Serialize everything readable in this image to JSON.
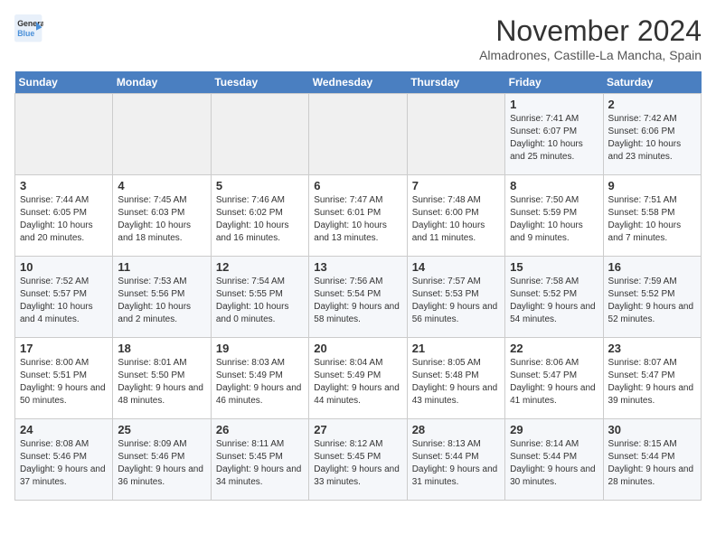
{
  "header": {
    "logo_line1": "General",
    "logo_line2": "Blue",
    "month": "November 2024",
    "location": "Almadrones, Castille-La Mancha, Spain"
  },
  "weekdays": [
    "Sunday",
    "Monday",
    "Tuesday",
    "Wednesday",
    "Thursday",
    "Friday",
    "Saturday"
  ],
  "weeks": [
    [
      {
        "day": "",
        "info": ""
      },
      {
        "day": "",
        "info": ""
      },
      {
        "day": "",
        "info": ""
      },
      {
        "day": "",
        "info": ""
      },
      {
        "day": "",
        "info": ""
      },
      {
        "day": "1",
        "info": "Sunrise: 7:41 AM\nSunset: 6:07 PM\nDaylight: 10 hours and 25 minutes."
      },
      {
        "day": "2",
        "info": "Sunrise: 7:42 AM\nSunset: 6:06 PM\nDaylight: 10 hours and 23 minutes."
      }
    ],
    [
      {
        "day": "3",
        "info": "Sunrise: 7:44 AM\nSunset: 6:05 PM\nDaylight: 10 hours and 20 minutes."
      },
      {
        "day": "4",
        "info": "Sunrise: 7:45 AM\nSunset: 6:03 PM\nDaylight: 10 hours and 18 minutes."
      },
      {
        "day": "5",
        "info": "Sunrise: 7:46 AM\nSunset: 6:02 PM\nDaylight: 10 hours and 16 minutes."
      },
      {
        "day": "6",
        "info": "Sunrise: 7:47 AM\nSunset: 6:01 PM\nDaylight: 10 hours and 13 minutes."
      },
      {
        "day": "7",
        "info": "Sunrise: 7:48 AM\nSunset: 6:00 PM\nDaylight: 10 hours and 11 minutes."
      },
      {
        "day": "8",
        "info": "Sunrise: 7:50 AM\nSunset: 5:59 PM\nDaylight: 10 hours and 9 minutes."
      },
      {
        "day": "9",
        "info": "Sunrise: 7:51 AM\nSunset: 5:58 PM\nDaylight: 10 hours and 7 minutes."
      }
    ],
    [
      {
        "day": "10",
        "info": "Sunrise: 7:52 AM\nSunset: 5:57 PM\nDaylight: 10 hours and 4 minutes."
      },
      {
        "day": "11",
        "info": "Sunrise: 7:53 AM\nSunset: 5:56 PM\nDaylight: 10 hours and 2 minutes."
      },
      {
        "day": "12",
        "info": "Sunrise: 7:54 AM\nSunset: 5:55 PM\nDaylight: 10 hours and 0 minutes."
      },
      {
        "day": "13",
        "info": "Sunrise: 7:56 AM\nSunset: 5:54 PM\nDaylight: 9 hours and 58 minutes."
      },
      {
        "day": "14",
        "info": "Sunrise: 7:57 AM\nSunset: 5:53 PM\nDaylight: 9 hours and 56 minutes."
      },
      {
        "day": "15",
        "info": "Sunrise: 7:58 AM\nSunset: 5:52 PM\nDaylight: 9 hours and 54 minutes."
      },
      {
        "day": "16",
        "info": "Sunrise: 7:59 AM\nSunset: 5:52 PM\nDaylight: 9 hours and 52 minutes."
      }
    ],
    [
      {
        "day": "17",
        "info": "Sunrise: 8:00 AM\nSunset: 5:51 PM\nDaylight: 9 hours and 50 minutes."
      },
      {
        "day": "18",
        "info": "Sunrise: 8:01 AM\nSunset: 5:50 PM\nDaylight: 9 hours and 48 minutes."
      },
      {
        "day": "19",
        "info": "Sunrise: 8:03 AM\nSunset: 5:49 PM\nDaylight: 9 hours and 46 minutes."
      },
      {
        "day": "20",
        "info": "Sunrise: 8:04 AM\nSunset: 5:49 PM\nDaylight: 9 hours and 44 minutes."
      },
      {
        "day": "21",
        "info": "Sunrise: 8:05 AM\nSunset: 5:48 PM\nDaylight: 9 hours and 43 minutes."
      },
      {
        "day": "22",
        "info": "Sunrise: 8:06 AM\nSunset: 5:47 PM\nDaylight: 9 hours and 41 minutes."
      },
      {
        "day": "23",
        "info": "Sunrise: 8:07 AM\nSunset: 5:47 PM\nDaylight: 9 hours and 39 minutes."
      }
    ],
    [
      {
        "day": "24",
        "info": "Sunrise: 8:08 AM\nSunset: 5:46 PM\nDaylight: 9 hours and 37 minutes."
      },
      {
        "day": "25",
        "info": "Sunrise: 8:09 AM\nSunset: 5:46 PM\nDaylight: 9 hours and 36 minutes."
      },
      {
        "day": "26",
        "info": "Sunrise: 8:11 AM\nSunset: 5:45 PM\nDaylight: 9 hours and 34 minutes."
      },
      {
        "day": "27",
        "info": "Sunrise: 8:12 AM\nSunset: 5:45 PM\nDaylight: 9 hours and 33 minutes."
      },
      {
        "day": "28",
        "info": "Sunrise: 8:13 AM\nSunset: 5:44 PM\nDaylight: 9 hours and 31 minutes."
      },
      {
        "day": "29",
        "info": "Sunrise: 8:14 AM\nSunset: 5:44 PM\nDaylight: 9 hours and 30 minutes."
      },
      {
        "day": "30",
        "info": "Sunrise: 8:15 AM\nSunset: 5:44 PM\nDaylight: 9 hours and 28 minutes."
      }
    ]
  ]
}
